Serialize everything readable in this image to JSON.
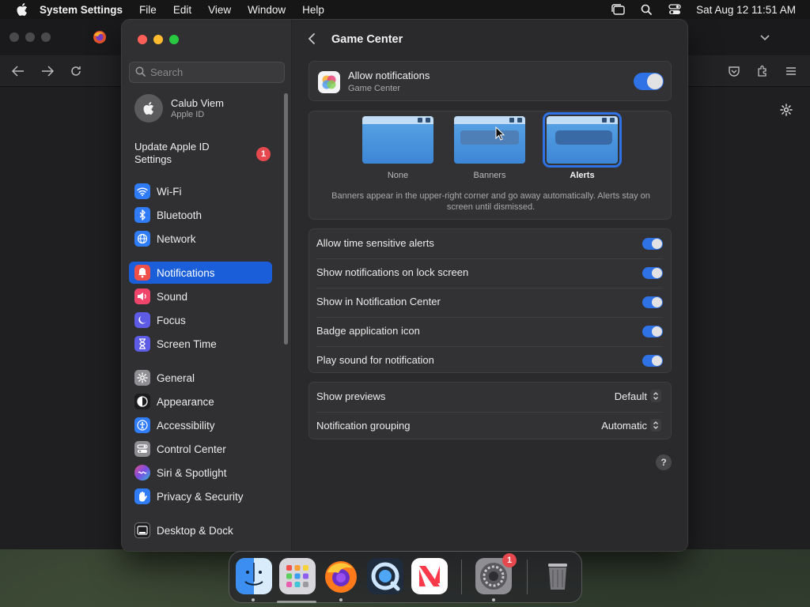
{
  "menubar": {
    "app_name": "System Settings",
    "menus": [
      "File",
      "Edit",
      "View",
      "Window",
      "Help"
    ],
    "clock": "Sat Aug 12  11:51 AM"
  },
  "search": {
    "placeholder": "Search",
    "value": ""
  },
  "apple_id": {
    "name": "Calub Viem",
    "sub": "Apple ID"
  },
  "update": {
    "label": "Update Apple ID Settings",
    "badge": "1"
  },
  "sidebar": {
    "items": [
      {
        "label": "Wi-Fi",
        "icon": "wifi-icon",
        "color": "#2f7cf6"
      },
      {
        "label": "Bluetooth",
        "icon": "bluetooth-icon",
        "color": "#2f7cf6"
      },
      {
        "label": "Network",
        "icon": "globe-icon",
        "color": "#2f7cf6"
      },
      {
        "label": "Notifications",
        "icon": "bell-icon",
        "color": "#f0504a",
        "active": true
      },
      {
        "label": "Sound",
        "icon": "speaker-icon",
        "color": "#f0446b"
      },
      {
        "label": "Focus",
        "icon": "moon-icon",
        "color": "#5e5ce6"
      },
      {
        "label": "Screen Time",
        "icon": "hourglass-icon",
        "color": "#5e5ce6"
      },
      {
        "label": "General",
        "icon": "gear-icon",
        "color": "#8e8e93"
      },
      {
        "label": "Appearance",
        "icon": "appearance-icon",
        "color": "#1c1c1e"
      },
      {
        "label": "Accessibility",
        "icon": "accessibility-icon",
        "color": "#2f7cf6"
      },
      {
        "label": "Control Center",
        "icon": "control-center-icon",
        "color": "#8e8e93"
      },
      {
        "label": "Siri & Spotlight",
        "icon": "siri-icon",
        "color": "#b04cd8"
      },
      {
        "label": "Privacy & Security",
        "icon": "hand-icon",
        "color": "#2f7cf6"
      },
      {
        "label": "Desktop & Dock",
        "icon": "dock-icon",
        "color": "#1c1c1e"
      }
    ]
  },
  "main": {
    "title": "Game Center",
    "allow": {
      "label": "Allow notifications",
      "sub": "Game Center",
      "on": true
    },
    "styles": [
      {
        "label": "None",
        "selected": false
      },
      {
        "label": "Banners",
        "selected": false
      },
      {
        "label": "Alerts",
        "selected": true
      }
    ],
    "style_desc": "Banners appear in the upper-right corner and go away automatically. Alerts stay on screen until dismissed.",
    "toggles": [
      {
        "label": "Allow time sensitive alerts",
        "on": true
      },
      {
        "label": "Show notifications on lock screen",
        "on": true
      },
      {
        "label": "Show in Notification Center",
        "on": true
      },
      {
        "label": "Badge application icon",
        "on": true
      },
      {
        "label": "Play sound for notification",
        "on": true
      }
    ],
    "selects": [
      {
        "label": "Show previews",
        "value": "Default"
      },
      {
        "label": "Notification grouping",
        "value": "Automatic"
      }
    ],
    "help": "?"
  },
  "dock": {
    "apps": [
      "Finder",
      "Launchpad",
      "Firefox",
      "QuickTime Player",
      "News",
      "System Settings",
      "Trash"
    ],
    "settings_badge": "1"
  },
  "colors": {
    "accent": "#2f72e6",
    "sidebar_active": "#1a5fd9",
    "badge": "#e5484d"
  }
}
